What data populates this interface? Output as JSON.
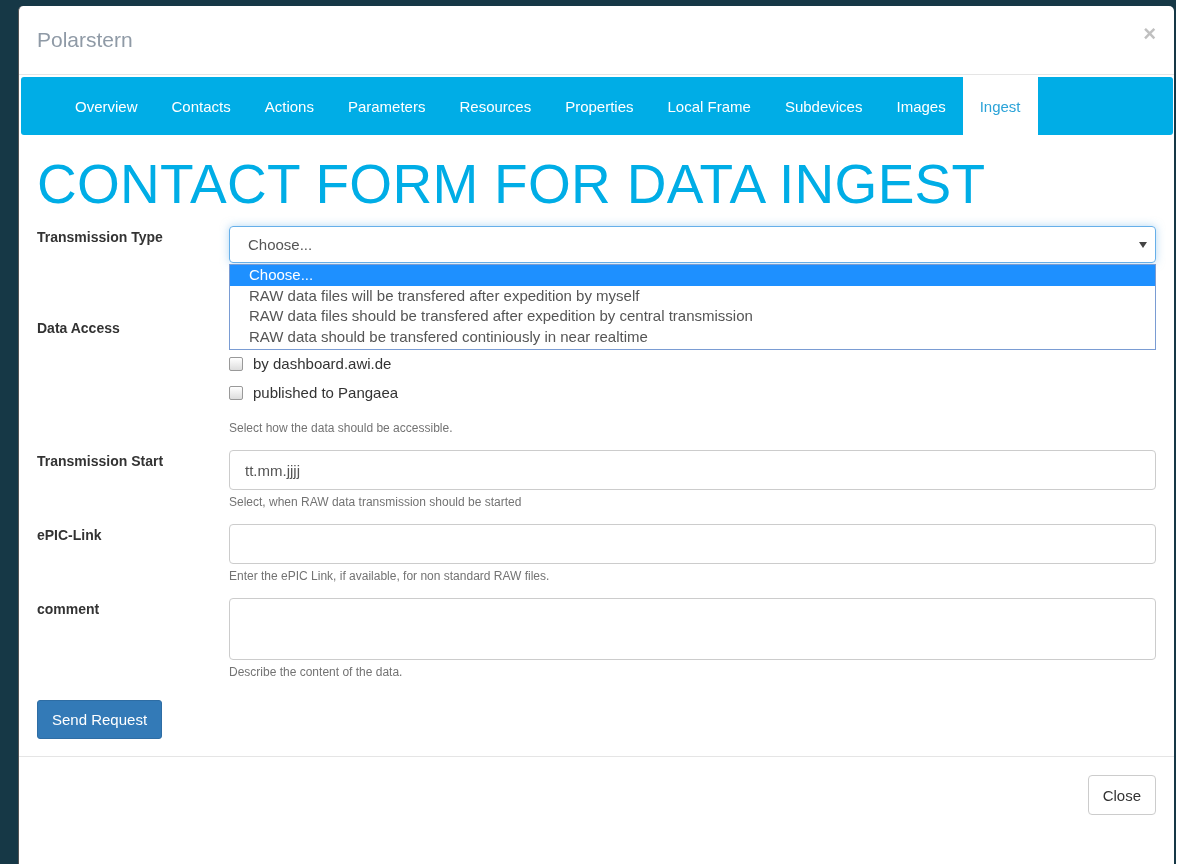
{
  "window": {
    "title": "Polarstern",
    "close": "×"
  },
  "tabs": [
    {
      "label": "Overview",
      "selected": false
    },
    {
      "label": "Contacts",
      "selected": false
    },
    {
      "label": "Actions",
      "selected": false
    },
    {
      "label": "Parameters",
      "selected": false
    },
    {
      "label": "Resources",
      "selected": false
    },
    {
      "label": "Properties",
      "selected": false
    },
    {
      "label": "Local Frame",
      "selected": false
    },
    {
      "label": "Subdevices",
      "selected": false
    },
    {
      "label": "Images",
      "selected": false
    },
    {
      "label": "Ingest",
      "selected": true
    }
  ],
  "heading": "CONTACT FORM FOR DATA INGEST",
  "fields": [
    {
      "kind": "select",
      "label": "Transmission Type",
      "value": "Choose...",
      "expanded": true,
      "options": [
        {
          "label": "Choose...",
          "selected": true
        },
        {
          "label": "RAW data files will be transfered after expedition by myself",
          "selected": false
        },
        {
          "label": "RAW data files should be transfered after expedition by central transmission",
          "selected": false
        },
        {
          "label": "RAW data should be transfered continiously in near realtime",
          "selected": false
        }
      ]
    },
    {
      "kind": "checkboxes",
      "label": "Data Access",
      "options": [
        {
          "label": "by dashboard.awi.de",
          "checked": false
        },
        {
          "label": "published to Pangaea",
          "checked": false
        }
      ],
      "help": "Select how the data should be accessible."
    },
    {
      "kind": "input",
      "label": "Transmission Start",
      "placeholder": "tt.mm.jjjj",
      "help": "Select, when RAW data transmission should be started"
    },
    {
      "kind": "input",
      "label": "ePIC-Link",
      "help": "Enter the ePIC Link, if available, for non standard RAW files."
    },
    {
      "kind": "textarea",
      "label": "comment",
      "help": "Describe the content of the data."
    }
  ],
  "submit": "Send Request",
  "footer": {
    "close": "Close"
  }
}
